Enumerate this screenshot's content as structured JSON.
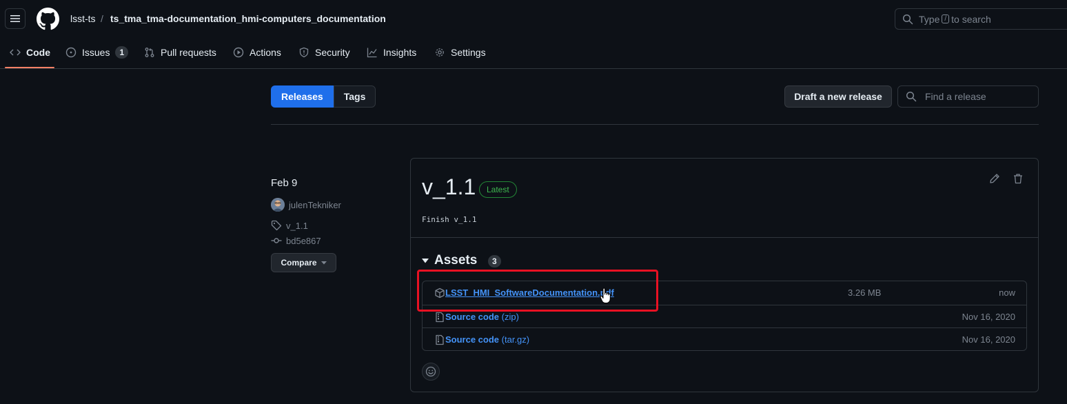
{
  "header": {
    "owner": "lsst-ts",
    "separator": "/",
    "repo": "ts_tma_tma-documentation_hmi-computers_documentation",
    "search_text_before": "Type",
    "search_key": "/",
    "search_text_after": "to search"
  },
  "nav": {
    "tabs": [
      {
        "label": "Code",
        "icon": "code-icon",
        "active": true
      },
      {
        "label": "Issues",
        "icon": "issue-opened-icon",
        "count": "1"
      },
      {
        "label": "Pull requests",
        "icon": "git-pull-request-icon"
      },
      {
        "label": "Actions",
        "icon": "play-icon"
      },
      {
        "label": "Security",
        "icon": "shield-icon"
      },
      {
        "label": "Insights",
        "icon": "graph-icon"
      },
      {
        "label": "Settings",
        "icon": "gear-icon"
      }
    ]
  },
  "subnav": {
    "releases_label": "Releases",
    "tags_label": "Tags",
    "draft_label": "Draft a new release",
    "find_placeholder": "Find a release"
  },
  "release": {
    "date": "Feb 9",
    "author": "julenTekniker",
    "tag": "v_1.1",
    "commit": "bd5e867",
    "compare_label": "Compare",
    "title": "v_1.1",
    "badge": "Latest",
    "body": "Finish v_1.1",
    "assets_label": "Assets",
    "assets_count": "3",
    "assets": [
      {
        "name": "LSST_HMI_SoftwareDocumentation.pdf",
        "size": "3.26 MB",
        "date": "now"
      },
      {
        "name": "Source code",
        "format": "(zip)",
        "date": "Nov 16, 2020"
      },
      {
        "name": "Source code",
        "format": "(tar.gz)",
        "date": "Nov 16, 2020"
      }
    ]
  },
  "colors": {
    "accent": "#1f6feb",
    "link": "#4493f8",
    "latest_badge": "#3fb950",
    "highlight": "#e81123",
    "nav_underline": "#f78166"
  }
}
